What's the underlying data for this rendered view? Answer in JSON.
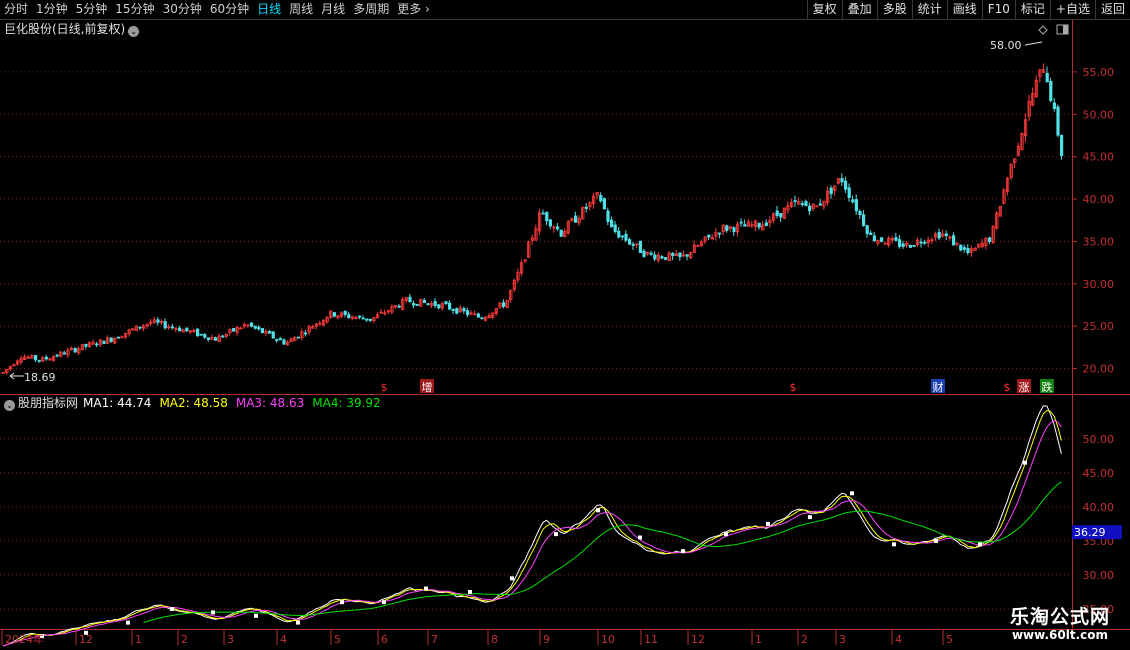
{
  "toolbar": {
    "periods": [
      "分时",
      "1分钟",
      "5分钟",
      "15分钟",
      "30分钟",
      "60分钟",
      "日线",
      "周线",
      "月线",
      "多周期",
      "更多"
    ],
    "active_period": "日线",
    "tools": [
      "复权",
      "叠加",
      "多股",
      "统计",
      "画线",
      "F10",
      "标记",
      "+自选",
      "返回"
    ]
  },
  "stock": {
    "title": "巨化股份(日线,前复权)"
  },
  "main_chart": {
    "price_axis": [
      "55.00",
      "50.00",
      "45.00",
      "40.00",
      "35.00",
      "30.00",
      "25.00",
      "20.00"
    ],
    "high_label": "58.00",
    "low_label": "18.69",
    "event_markers": [
      "$",
      "增",
      "$",
      "财",
      "$",
      "涨",
      "跌"
    ]
  },
  "indicator": {
    "name": "股朋指标网",
    "ma1": "MA1: 44.74",
    "ma2": "MA2: 48.58",
    "ma3": "MA3: 48.63",
    "ma4": "MA4: 39.92",
    "axis": [
      "50.00",
      "45.00",
      "40.00",
      "35.00",
      "30.00",
      "25.00"
    ],
    "current_value": "36.29"
  },
  "time_axis": [
    "2024年",
    "12",
    "1",
    "2",
    "3",
    "4",
    "5",
    "6",
    "7",
    "8",
    "9",
    "10",
    "11",
    "12",
    "1",
    "2",
    "3",
    "4",
    "5"
  ],
  "watermark": {
    "line1": "乐淘公式网",
    "line2": "www.60lt.com"
  },
  "colors": {
    "up": "#ff3b3b",
    "down": "#4fe0e8",
    "ma1": "#ffffff",
    "ma2": "#ffff00",
    "ma3": "#ff40ff",
    "ma4": "#00e000"
  },
  "chart_data": {
    "type": "candlestick",
    "title": "巨化股份(日线,前复权)",
    "y_range": [
      17,
      59
    ],
    "series_close_approx": [
      {
        "month": "2024-11",
        "close": 19.5
      },
      {
        "month": "2024-12",
        "close": 21.5
      },
      {
        "month": "2025-01",
        "close": 23.5
      },
      {
        "month": "2025-02",
        "close": 25.0
      },
      {
        "month": "2025-03",
        "close": 24.0
      },
      {
        "month": "2025-04",
        "close": 22.5
      },
      {
        "month": "2025-05",
        "close": 26.0
      },
      {
        "month": "2025-06",
        "close": 27.0
      },
      {
        "month": "2025-07",
        "close": 28.5
      },
      {
        "month": "2025-08",
        "close": 30.0
      },
      {
        "month": "2025-09",
        "close": 37.0
      },
      {
        "month": "2025-10",
        "close": 36.0
      },
      {
        "month": "2025-11",
        "close": 34.0
      },
      {
        "month": "2025-12",
        "close": 37.5
      },
      {
        "month": "2026-01",
        "close": 38.0
      },
      {
        "month": "2026-02",
        "close": 40.5
      },
      {
        "month": "2026-03",
        "close": 42.5
      },
      {
        "month": "2026-04",
        "close": 34.5
      },
      {
        "month": "2026-05",
        "close": 35.5
      },
      {
        "month": "2026-06",
        "close": 42.0
      }
    ],
    "high": 58.0,
    "low": 18.69
  }
}
